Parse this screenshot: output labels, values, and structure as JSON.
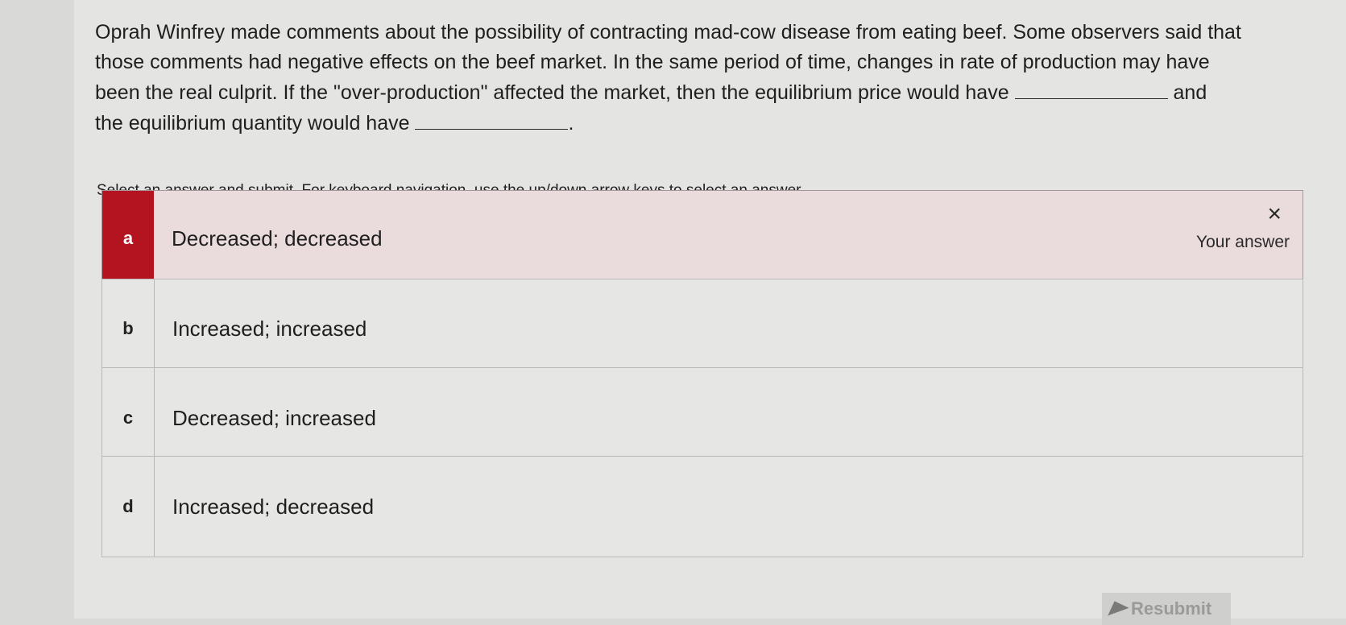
{
  "question": {
    "line1": "Oprah Winfrey made comments about the possibility of contracting mad-cow disease from eating beef. Some observers said that",
    "line2": "those comments had negative effects on the beef market. In the same period of time, changes in rate of production may have",
    "line3_before": "been the real culprit. If the \"over-production\" affected the market, then the equilibrium price would have",
    "line3_after": "and",
    "line4_before": "the equilibrium quantity would have",
    "line4_after": "."
  },
  "instructions": "Select an answer and submit. For keyboard navigation, use the up/down arrow keys to select an answer.",
  "options": [
    {
      "letter": "a",
      "text": "Decreased; decreased",
      "selected": true,
      "status_label": "Your answer",
      "status_icon": "×"
    },
    {
      "letter": "b",
      "text": "Increased; increased"
    },
    {
      "letter": "c",
      "text": "Decreased; increased"
    },
    {
      "letter": "d",
      "text": "Increased; decreased"
    }
  ],
  "submit_label": "Resubmit",
  "colors": {
    "selected_accent": "#b3141f",
    "selected_bg": "#eadcdc",
    "background": "#e4e4e2"
  }
}
